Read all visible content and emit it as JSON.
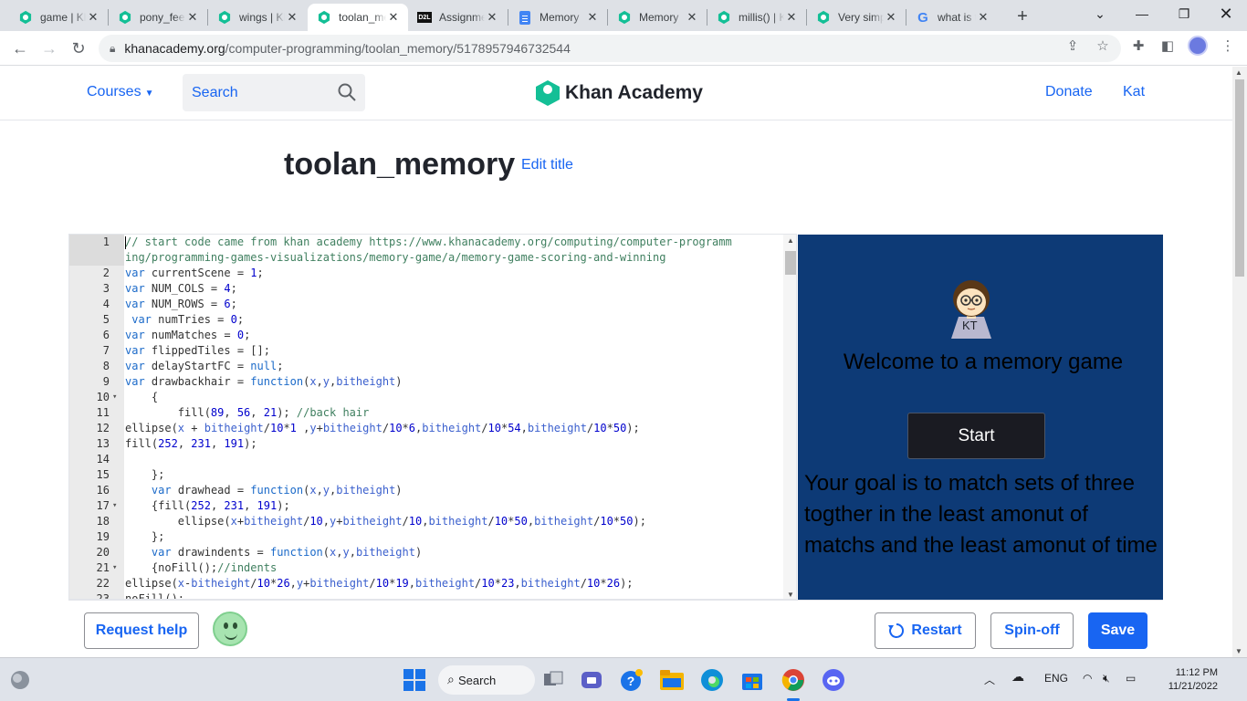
{
  "browser": {
    "tabs": [
      {
        "title": "game | Khan Academy",
        "icon": "khan-academy-icon"
      },
      {
        "title": "pony_feet | Khan Academy",
        "icon": "khan-academy-icon"
      },
      {
        "title": "wings | Khan Academy",
        "icon": "khan-academy-icon"
      },
      {
        "title": "toolan_memory",
        "icon": "khan-academy-icon",
        "active": true
      },
      {
        "title": "Assignments",
        "icon": "d2l-icon"
      },
      {
        "title": "Memory",
        "icon": "docs-icon"
      },
      {
        "title": "Memory",
        "icon": "khan-academy-icon"
      },
      {
        "title": "millis() | Khan Academy",
        "icon": "khan-academy-icon"
      },
      {
        "title": "Very simple",
        "icon": "khan-academy-icon"
      },
      {
        "title": "what is the",
        "icon": "google-icon"
      }
    ],
    "d2l_badge": "D2L",
    "url_host": "khanacademy.org",
    "url_path": "/computer-programming/toolan_memory/5178957946732544"
  },
  "header": {
    "courses_label": "Courses",
    "search_placeholder": "Search",
    "logo_text": "Khan Academy",
    "donate_label": "Donate",
    "user_label": "Kat"
  },
  "program": {
    "title": "toolan_memory",
    "edit_title_label": "Edit title"
  },
  "code_lines": [
    {
      "n": "1",
      "fold": false,
      "text": "// start code came from khan academy https://www.khanacademy.org/computing/computer-programm"
    },
    {
      "n": "",
      "fold": false,
      "text": "ing/programming-games-visualizations/memory-game/a/memory-game-scoring-and-winning"
    },
    {
      "n": "2",
      "fold": false,
      "text": "var currentScene = 1;"
    },
    {
      "n": "3",
      "fold": false,
      "text": "var NUM_COLS = 4;"
    },
    {
      "n": "4",
      "fold": false,
      "text": "var NUM_ROWS = 6;"
    },
    {
      "n": "5",
      "fold": false,
      "text": " var numTries = 0;"
    },
    {
      "n": "6",
      "fold": false,
      "text": "var numMatches = 0;"
    },
    {
      "n": "7",
      "fold": false,
      "text": "var flippedTiles = [];"
    },
    {
      "n": "8",
      "fold": false,
      "text": "var delayStartFC = null;"
    },
    {
      "n": "9",
      "fold": false,
      "text": "var drawbackhair = function(x,y,bitheight)"
    },
    {
      "n": "10",
      "fold": true,
      "text": "    {"
    },
    {
      "n": "11",
      "fold": false,
      "text": "        fill(89, 56, 21); //back hair"
    },
    {
      "n": "12",
      "fold": false,
      "text": "ellipse(x + bitheight/10*1 ,y+bitheight/10*6,bitheight/10*54,bitheight/10*50);"
    },
    {
      "n": "13",
      "fold": false,
      "text": "fill(252, 231, 191);"
    },
    {
      "n": "14",
      "fold": false,
      "text": ""
    },
    {
      "n": "15",
      "fold": false,
      "text": "    };"
    },
    {
      "n": "16",
      "fold": false,
      "text": "    var drawhead = function(x,y,bitheight)"
    },
    {
      "n": "17",
      "fold": true,
      "text": "    {fill(252, 231, 191);"
    },
    {
      "n": "18",
      "fold": false,
      "text": "        ellipse(x+bitheight/10,y+bitheight/10,bitheight/10*50,bitheight/10*50);"
    },
    {
      "n": "19",
      "fold": false,
      "text": "    };"
    },
    {
      "n": "20",
      "fold": false,
      "text": "    var drawindents = function(x,y,bitheight)"
    },
    {
      "n": "21",
      "fold": true,
      "text": "    {noFill();//indents"
    },
    {
      "n": "22",
      "fold": false,
      "text": "ellipse(x-bitheight/10*26,y+bitheight/10*19,bitheight/10*23,bitheight/10*26);"
    },
    {
      "n": "23",
      "fold": false,
      "text": "noFill();"
    }
  ],
  "canvas": {
    "avatar_initials": "KT",
    "welcome_text": "Welcome to a memory game",
    "start_label": "Start",
    "goal_text": "Your goal is to match sets of three togther in the least amonut of matchs and the least amonut of time",
    "background_color": "#0d3a76"
  },
  "bottom_bar": {
    "request_help_label": "Request help",
    "restart_label": "Restart",
    "spinoff_label": "Spin-off",
    "save_label": "Save"
  },
  "taskbar": {
    "search_label": "Search",
    "language": "ENG",
    "time": "11:12 PM",
    "date": "11/21/2022"
  },
  "colors": {
    "ka_blue": "#1865f2",
    "ka_green": "#14bf96"
  }
}
